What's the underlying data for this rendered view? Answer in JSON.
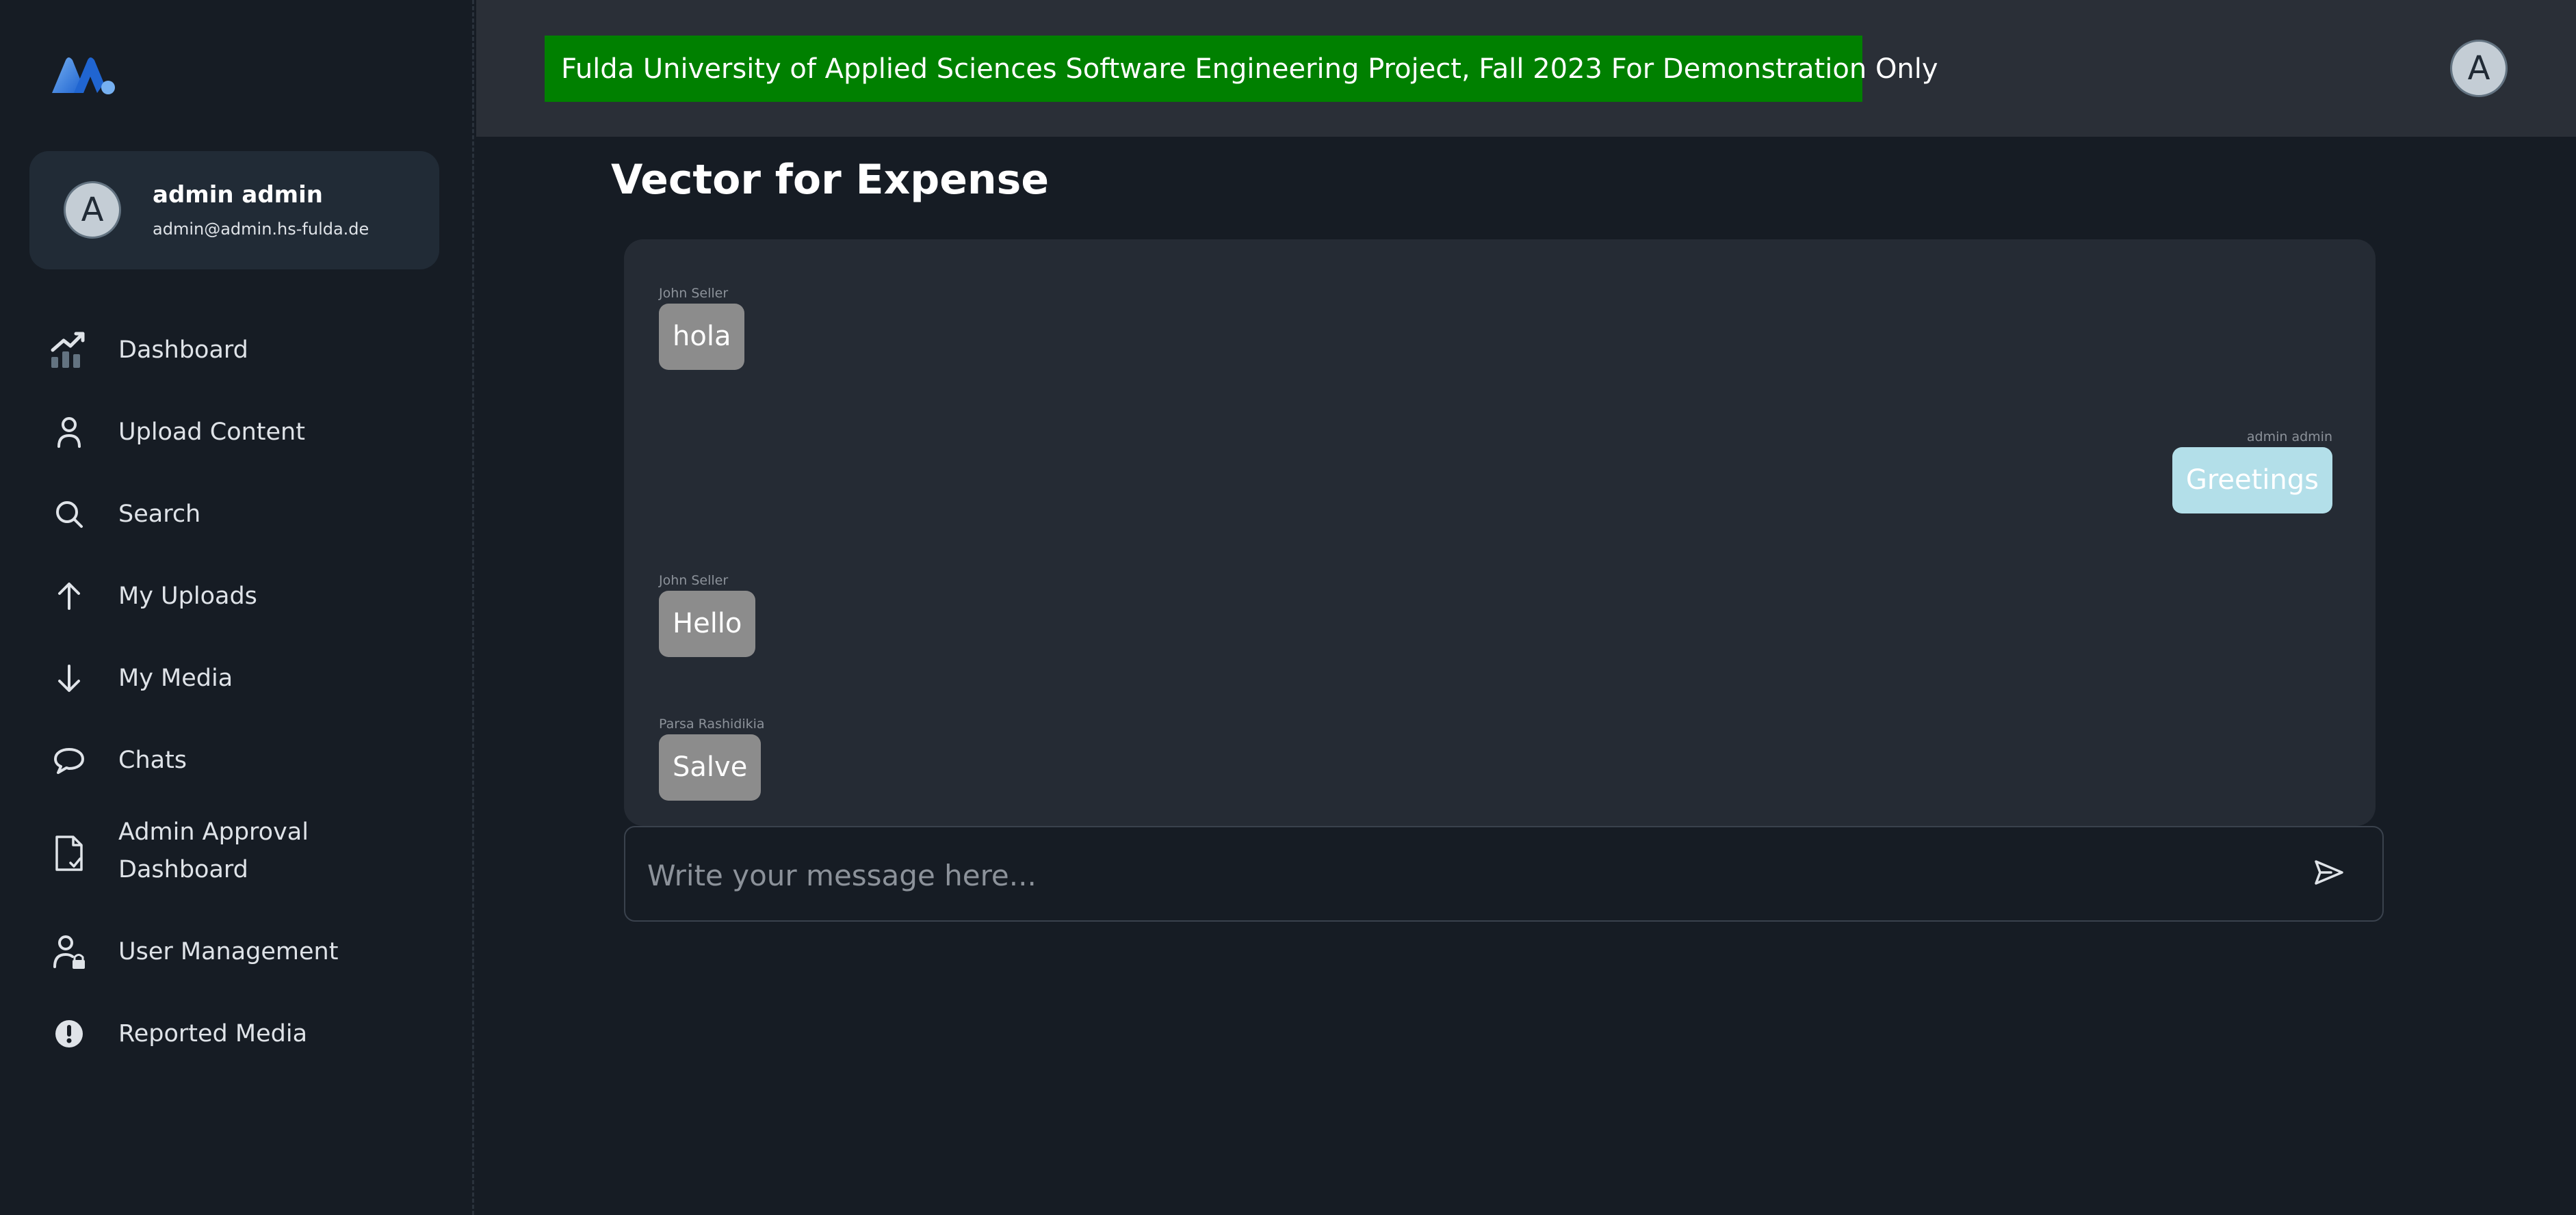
{
  "app": {
    "logo_icon": "brand-logo-icon"
  },
  "account": {
    "avatar_initial": "A",
    "name": "admin admin",
    "email": "admin@admin.hs-fulda.de"
  },
  "nav": {
    "items": [
      {
        "label": "Dashboard",
        "icon": "analytics-icon"
      },
      {
        "label": "Upload Content",
        "icon": "user-icon"
      },
      {
        "label": "Search",
        "icon": "search-icon"
      },
      {
        "label": "My Uploads",
        "icon": "arrow-up-icon"
      },
      {
        "label": "My Media",
        "icon": "arrow-down-icon"
      },
      {
        "label": "Chats",
        "icon": "chat-bubble-icon"
      },
      {
        "label": "Admin Approval\nDashboard",
        "icon": "document-check-icon"
      },
      {
        "label": "User Management",
        "icon": "user-lock-icon"
      },
      {
        "label": "Reported Media",
        "icon": "alert-icon"
      }
    ]
  },
  "header": {
    "banner": "Fulda University of Applied Sciences Software Engineering Project, Fall 2023 For Demonstration Only",
    "avatar_initial": "A",
    "banner_color": "#008000"
  },
  "chat": {
    "title": "Vector for Expense",
    "messages": [
      {
        "sender": "John Seller",
        "text": "hola",
        "direction": "incoming"
      },
      {
        "sender": "admin admin",
        "text": "Greetings",
        "direction": "outgoing"
      },
      {
        "sender": "John Seller",
        "text": "Hello",
        "direction": "incoming"
      },
      {
        "sender": "Parsa Rashidikia",
        "text": "Salve",
        "direction": "incoming"
      }
    ]
  },
  "composer": {
    "placeholder": "Write your message here...",
    "value": "",
    "send_icon": "send-icon"
  },
  "colors": {
    "background": "#161c24",
    "topbar": "#2a2f37",
    "panel": "#252b34",
    "incoming_bubble": "#8c8c8c",
    "outgoing_bubble": "#b3dfe9"
  }
}
